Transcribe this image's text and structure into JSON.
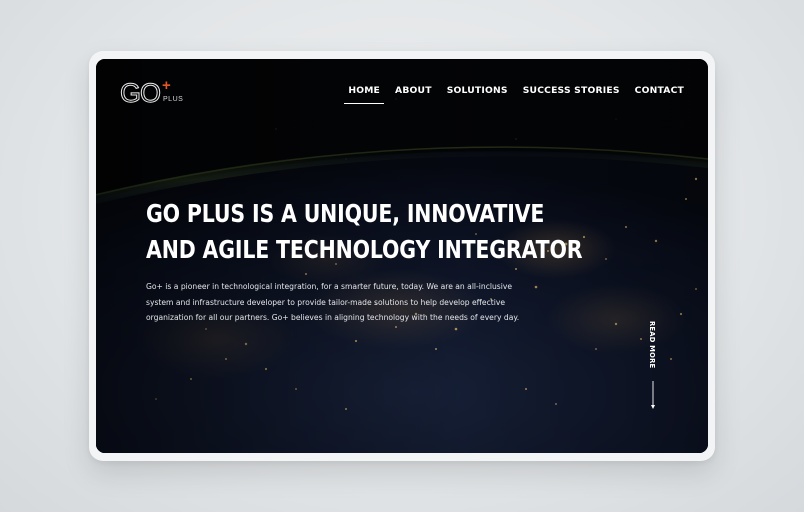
{
  "brand": {
    "logo_main": "GO",
    "logo_plus_sign": "+",
    "logo_plus_text": "PLUS"
  },
  "nav": {
    "items": [
      {
        "label": "HOME",
        "active": true
      },
      {
        "label": "ABOUT",
        "active": false
      },
      {
        "label": "SOLUTIONS",
        "active": false
      },
      {
        "label": "SUCCESS STORIES",
        "active": false
      },
      {
        "label": "CONTACT",
        "active": false
      }
    ]
  },
  "hero": {
    "headline_line1": "GO PLUS IS A UNIQUE, INNOVATIVE",
    "headline_line2": "AND AGILE TECHNOLOGY INTEGRATOR",
    "desc_line1": "Go+ is a pioneer in technological integration, for a smarter future, today. We are an all-inclusive",
    "desc_line2": "system and infrastructure developer to provide tailor-made solutions to help develop effective",
    "desc_line3": "organization for all our partners. Go+ believes in aligning technology with the needs of every day.",
    "read_more": "READ MORE"
  },
  "colors": {
    "accent": "#e2562a",
    "background": "#050608",
    "text": "#ffffff"
  },
  "icons": {
    "scroll": "arrow-down-icon",
    "logo": "go-plus-logo"
  }
}
